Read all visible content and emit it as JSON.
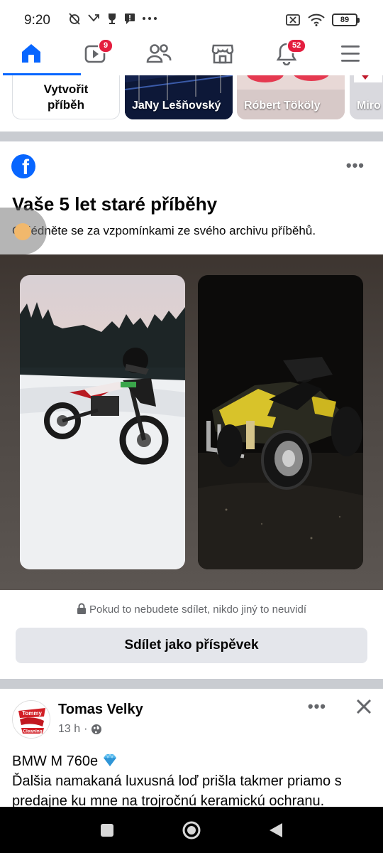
{
  "status_bar": {
    "time": "9:20",
    "battery": "89"
  },
  "nav": {
    "video_badge": "9",
    "notifications_badge": "52",
    "accent": "#0866ff"
  },
  "stories": {
    "create_label_line1": "Vytvořit",
    "create_label_line2": "příběh",
    "items": [
      {
        "name": "JaNy Lešňovský"
      },
      {
        "name": "Róbert Tököly"
      },
      {
        "name": "Miro"
      }
    ]
  },
  "memories": {
    "title": "Vaše 5 let staré příběhy",
    "subtitle": "Ohlédněte se za vzpomínkami ze svého archivu příběhů.",
    "privacy_note": "Pokud to nebudete sdílet, nikdo jiný to neuvidí",
    "share_button": "Sdílet jako příspěvek"
  },
  "post": {
    "author": "Tomas Velky",
    "time": "13 h",
    "separator": "·",
    "text_line1": "BMW M 760e",
    "text_line2": "Ďalšia namakaná luxusná loď prišla takmer priamo s predajne ku mne na trojročnú keramickú ochranu."
  }
}
